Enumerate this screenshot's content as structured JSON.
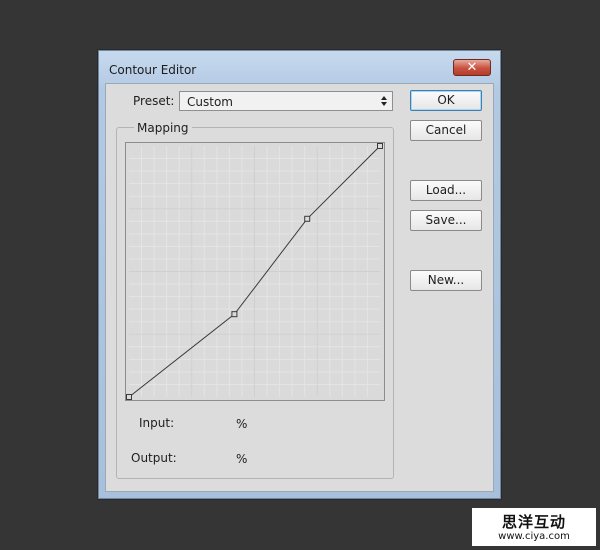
{
  "window": {
    "title": "Contour Editor"
  },
  "preset": {
    "label": "Preset:",
    "value": "Custom"
  },
  "buttons": {
    "ok": "OK",
    "cancel": "Cancel",
    "load": "Load...",
    "save": "Save...",
    "new": "New..."
  },
  "mapping": {
    "label": "Mapping",
    "curve_points": [
      {
        "input": 0,
        "output": 0
      },
      {
        "input": 42,
        "output": 33
      },
      {
        "input": 71,
        "output": 71
      },
      {
        "input": 100,
        "output": 100
      }
    ]
  },
  "input": {
    "label": "Input:",
    "unit": "%"
  },
  "output": {
    "label": "Output:",
    "unit": "%"
  },
  "watermark": {
    "text": "思洋互动",
    "url": "www.ciya.com"
  },
  "colors": {
    "background": "#353535",
    "dialog_face": "#dcdcdc",
    "title_bar": "#b3c9e3",
    "close_button": "#c8503f"
  }
}
